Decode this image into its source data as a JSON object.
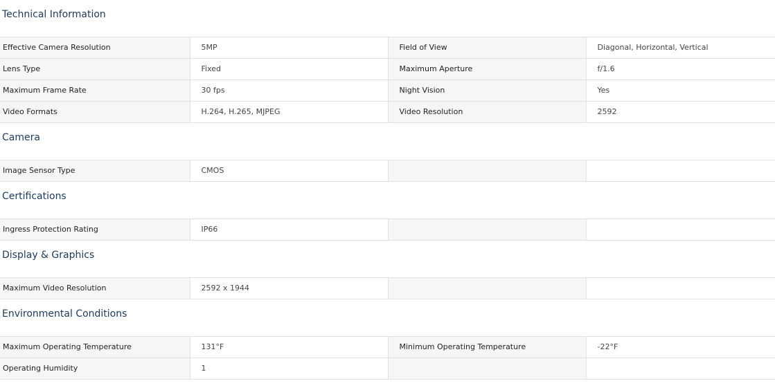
{
  "sections": [
    {
      "title": "Technical Information",
      "rows": [
        {
          "label": "Effective Camera Resolution",
          "value": "5MP",
          "label2": "Field of View",
          "value2": "Diagonal, Horizontal, Vertical"
        },
        {
          "label": "Lens Type",
          "value": "Fixed",
          "label2": "Maximum Aperture",
          "value2": "f/1.6"
        },
        {
          "label": "Maximum Frame Rate",
          "value": "30 fps",
          "label2": "Night Vision",
          "value2": "Yes"
        },
        {
          "label": "Video Formats",
          "value": "H.264, H.265, MJPEG",
          "label2": "Video Resolution",
          "value2": "2592"
        }
      ]
    },
    {
      "title": "Camera",
      "rows": [
        {
          "label": "Image Sensor Type",
          "value": "CMOS",
          "label2": "",
          "value2": ""
        }
      ]
    },
    {
      "title": "Certifications",
      "rows": [
        {
          "label": "Ingress Protection Rating",
          "value": "IP66",
          "label2": "",
          "value2": ""
        }
      ]
    },
    {
      "title": "Display & Graphics",
      "rows": [
        {
          "label": "Maximum Video Resolution",
          "value": "2592 x 1944",
          "label2": "",
          "value2": ""
        }
      ]
    },
    {
      "title": "Environmental Conditions",
      "rows": [
        {
          "label": "Maximum Operating Temperature",
          "value": "131°F",
          "label2": "Minimum Operating Temperature",
          "value2": "-22°F"
        },
        {
          "label": "Operating Humidity",
          "value": "1",
          "label2": "",
          "value2": ""
        }
      ]
    }
  ]
}
